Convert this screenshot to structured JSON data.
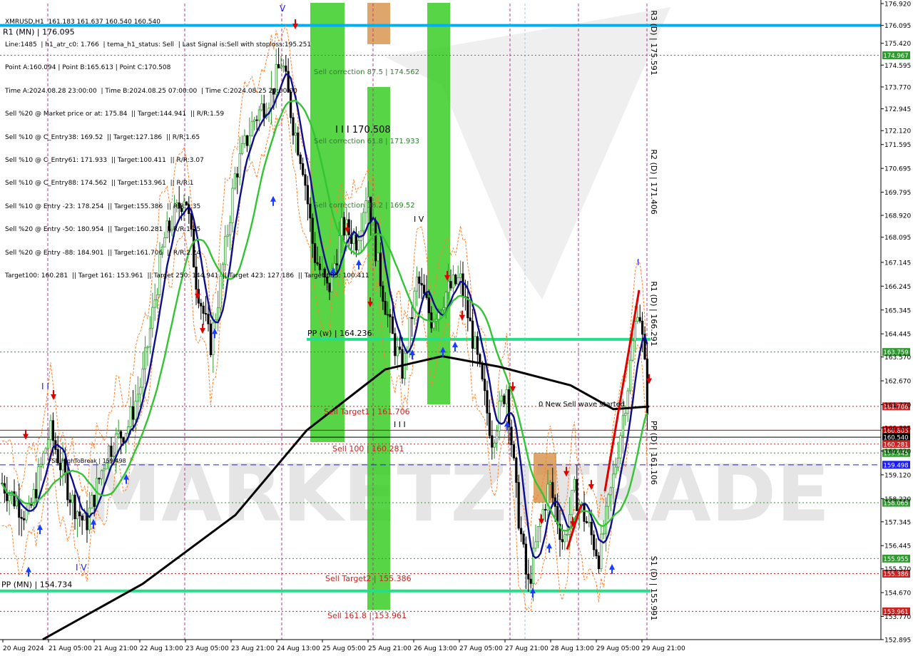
{
  "chart_data": {
    "type": "line",
    "symbol": "XMRUSD,H1",
    "ohlc_header": "XMRUSD,H1  161.183 161.637 160.540 160.540",
    "info_lines": [
      "Line:1485  | h1_atr_c0: 1.766  | tema_h1_status: Sell  | Last Signal is:Sell with stoploss:195.251",
      "Point A:160.094 | Point B:165.613 | Point C:170.508",
      "Time A:2024.08.28 23:00:00  | Time B:2024.08.25 07:00:00  | Time C:2024.08.25 20:00:00",
      "Sell %20 @ Market price or at: 175.84  || Target:144.941  || R/R:1.59",
      "Sell %10 @ C_Entry38: 169.52  || Target:127.186  || R/R:1.65",
      "Sell %10 @ C_Entry61: 171.933  || Target:100.411  || R/R:3.07",
      "Sell %10 @ C_Entry88: 174.562  || Target:153.961  || R/R:1",
      "Sell %10 @ Entry -23: 178.254  || Target:155.386  || R/R:1.35",
      "Sell %20 @ Entry -50: 180.954  || Target:160.281  || R/R:1.45",
      "Sell %20 @ Entry -88: 184.901  || Target:161.706  || R/R:2.24",
      "Target100: 160.281  || Target 161: 153.961  || Target 250: 144.941  || Target 423: 127.186  || Target 685: 100.411"
    ],
    "y_ticks": [
      "176.920",
      "176.095",
      "175.420",
      "174.595",
      "173.770",
      "172.945",
      "172.120",
      "171.595",
      "170.695",
      "169.795",
      "168.920",
      "168.095",
      "167.145",
      "166.245",
      "165.345",
      "164.445",
      "163.570",
      "162.670",
      "161.770",
      "160.895",
      "160.020",
      "159.120",
      "158.220",
      "157.345",
      "156.445",
      "155.570",
      "154.670",
      "153.770",
      "152.895"
    ],
    "ylim": [
      152.895,
      176.92
    ],
    "x_ticks": [
      "20 Aug 2024",
      "21 Aug 05:00",
      "21 Aug 21:00",
      "22 Aug 13:00",
      "23 Aug 05:00",
      "23 Aug 21:00",
      "24 Aug 13:00",
      "25 Aug 05:00",
      "25 Aug 21:00",
      "26 Aug 13:00",
      "27 Aug 05:00",
      "27 Aug 21:00",
      "28 Aug 13:00",
      "29 Aug 05:00",
      "29 Aug 21:00"
    ],
    "horizontal_levels": [
      {
        "value": 176.095,
        "label": "R1 (MN) | 176.095",
        "color": "#00b0f0",
        "style": "solid"
      },
      {
        "value": 174.967,
        "tag": "174.967",
        "color": "#2e9b2e",
        "style": "dotted"
      },
      {
        "value": 163.759,
        "tag": "163.759",
        "color": "#2e9b2e",
        "style": "dotted"
      },
      {
        "value": 161.706,
        "tag": "161.706",
        "color": "#cc2222",
        "style": "dotted"
      },
      {
        "value": 160.805,
        "tag": "160.805",
        "color": "#cc0000",
        "style": "solid"
      },
      {
        "value": 160.54,
        "tag": "160.540",
        "color": "#000000",
        "style": "solid"
      },
      {
        "value": 160.281,
        "tag": "160.281",
        "color": "#cc2222",
        "style": "dotted"
      },
      {
        "value": 159.945,
        "tag": "159.945",
        "color": "#2e9b2e",
        "style": "dotted"
      },
      {
        "value": 159.498,
        "tag": "159.498",
        "color": "#1a1aff",
        "style": "dashed"
      },
      {
        "value": 158.065,
        "tag": "158.065",
        "color": "#2e9b2e",
        "style": "dotted"
      },
      {
        "value": 155.955,
        "tag": "155.955",
        "color": "#2e9b2e",
        "style": "dotted"
      },
      {
        "value": 155.386,
        "tag": "155.386",
        "color": "#cc2222",
        "style": "dotted"
      },
      {
        "value": 153.961,
        "tag": "153.961",
        "color": "#cc2222",
        "style": "dotted"
      }
    ],
    "pivot_lines": [
      {
        "value": 164.236,
        "label": "PP (w) | 164.236",
        "x_from": 430,
        "x_to": 912
      },
      {
        "value": 154.734,
        "label": "PP (MN) | 154.734",
        "x_from": 0,
        "x_to": 912
      }
    ],
    "daily_pivots_vertical": [
      {
        "label": "R3 (D) | 175.591",
        "y": 60
      },
      {
        "label": "R2 (D) | 171.406",
        "y": 255
      },
      {
        "label": "R1 (D) | 166.291",
        "y": 440
      },
      {
        "label": "PP (D) | 161.106",
        "y": 635
      },
      {
        "label": "S1 (D) | 155.991",
        "y": 825
      }
    ],
    "annotations": [
      {
        "text": "Sell correction 87.5 | 174.562",
        "color": "#2e7d2e"
      },
      {
        "text": "I I I  170.508",
        "color": "#000000"
      },
      {
        "text": "Sell correction 61.8 | 171.933",
        "color": "#2e7d2e"
      },
      {
        "text": "Sell correction 38.2 | 169.52",
        "color": "#2e7d2e"
      },
      {
        "text": "I V",
        "color": "#000000"
      },
      {
        "text": "Sell Target1 | 161.706",
        "color": "#cc2222"
      },
      {
        "text": "I I I",
        "color": "#000000"
      },
      {
        "text": "Sell 100 | 160.281",
        "color": "#cc2222"
      },
      {
        "text": "Sell Target2 | 155.386",
        "color": "#cc2222"
      },
      {
        "text": "Sell 161.8 | 153.961",
        "color": "#cc2222"
      },
      {
        "text": "0 New Sell wave started",
        "color": "#000000"
      },
      {
        "text": "FSB-HighToBreak | 159.498",
        "color": "#000000"
      },
      {
        "text": "I V",
        "color": "#1a1aff"
      },
      {
        "text": "I I",
        "color": "#1a1aff"
      },
      {
        "text": "V",
        "color": "#1a1aff"
      },
      {
        "text": "I",
        "color": "#1a1aff"
      }
    ],
    "watermark": "MARKETZITRADE",
    "colors": {
      "bull": "#2e9b2e",
      "bear": "#000000",
      "ma_blue": "#0d0d8f",
      "ma_green": "#33c433",
      "ma_black": "#000000",
      "band_orange": "#ff7f27",
      "zone_green": "#33cc1f",
      "zone_orange": "#d4883a",
      "sell_arrow": "#e00000",
      "buy_arrow": "#1a3cff"
    }
  }
}
